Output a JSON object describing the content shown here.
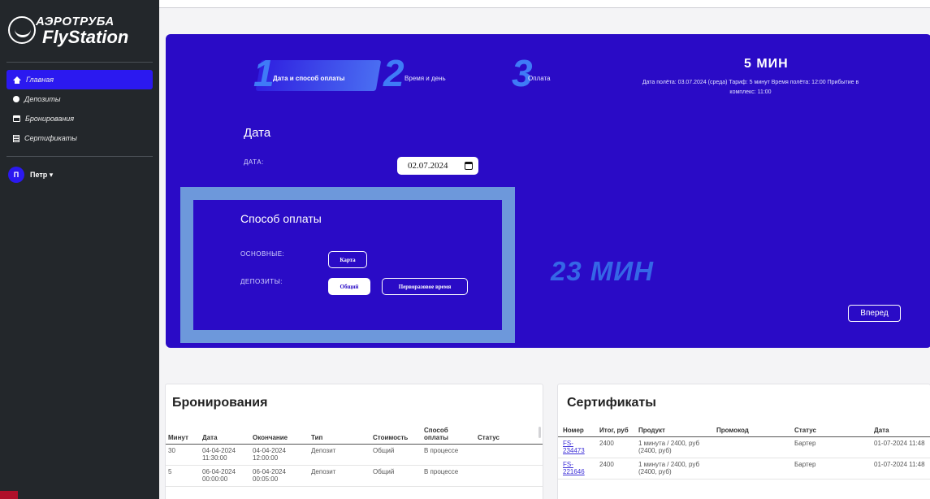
{
  "sidebar": {
    "logo": {
      "line1": "АЭРОТРУБА",
      "line2": "FlyStation"
    },
    "items": [
      {
        "label": "Главная",
        "icon": "house-icon",
        "active": true
      },
      {
        "label": "Депозиты",
        "icon": "coin-icon",
        "active": false
      },
      {
        "label": "Бронирования",
        "icon": "calendar-icon",
        "active": false
      },
      {
        "label": "Сертификаты",
        "icon": "doc-icon",
        "active": false
      }
    ],
    "user": {
      "initial": "П",
      "name": "Петр ▾"
    }
  },
  "steps": [
    {
      "number": "1",
      "label": "Дата и способ оплаты"
    },
    {
      "number": "2",
      "label": "Время и день"
    },
    {
      "number": "3",
      "label": "Оплата"
    }
  ],
  "summary": {
    "minutes": "5  МИН",
    "details": "Дата полёта: 03.07.2024 (среда) Тариф: 5 минут Время полёта: 12:00 Прибытие в комплекс: 11:00"
  },
  "date_section": {
    "heading": "Дата",
    "label": "ДАТА:",
    "value": "02.07.2024"
  },
  "payment": {
    "heading": "Способ оплаты",
    "main_label": "ОСНОВНЫЕ:",
    "main_options": [
      "Карта"
    ],
    "deposit_label": "ДЕПОЗИТЫ:",
    "deposit_options": [
      "Общий",
      "Перворазовое время"
    ],
    "selected": "Общий"
  },
  "remaining_minutes": "23 МИН",
  "next_button": "Вперед",
  "bookings": {
    "title": "Бронирования",
    "columns": [
      "Минут",
      "Дата",
      "Окончание",
      "Тип",
      "Стоимость",
      "Способ оплаты",
      "Статус"
    ],
    "rows": [
      [
        "30",
        "04-04-2024 11:30:00",
        "04-04-2024 12:00:00",
        "Депозит",
        "Общий",
        "В процессе",
        ""
      ],
      [
        "5",
        "06-04-2024 00:00:00",
        "06-04-2024 00:05:00",
        "Депозит",
        "Общий",
        "В процессе",
        ""
      ]
    ]
  },
  "certificates": {
    "title": "Сертификаты",
    "columns": [
      "Номер",
      "Итог, руб",
      "Продукт",
      "Промокод",
      "Статус",
      "Дата"
    ],
    "rows": [
      [
        "FS-234473",
        "2400",
        "1 минута / 2400, руб (2400, руб)",
        "",
        "Бартер",
        "01-07-2024 11:48"
      ],
      [
        "FS-221646",
        "2400",
        "1 минута / 2400, руб (2400, руб)",
        "",
        "Бартер",
        "01-07-2024 11:48"
      ]
    ]
  },
  "colors": {
    "panel": "#2a0bc6",
    "accent": "#3f7bf7",
    "frame": "#6d98db",
    "sidebar": "#23272b",
    "active_nav": "#2b19f0"
  }
}
